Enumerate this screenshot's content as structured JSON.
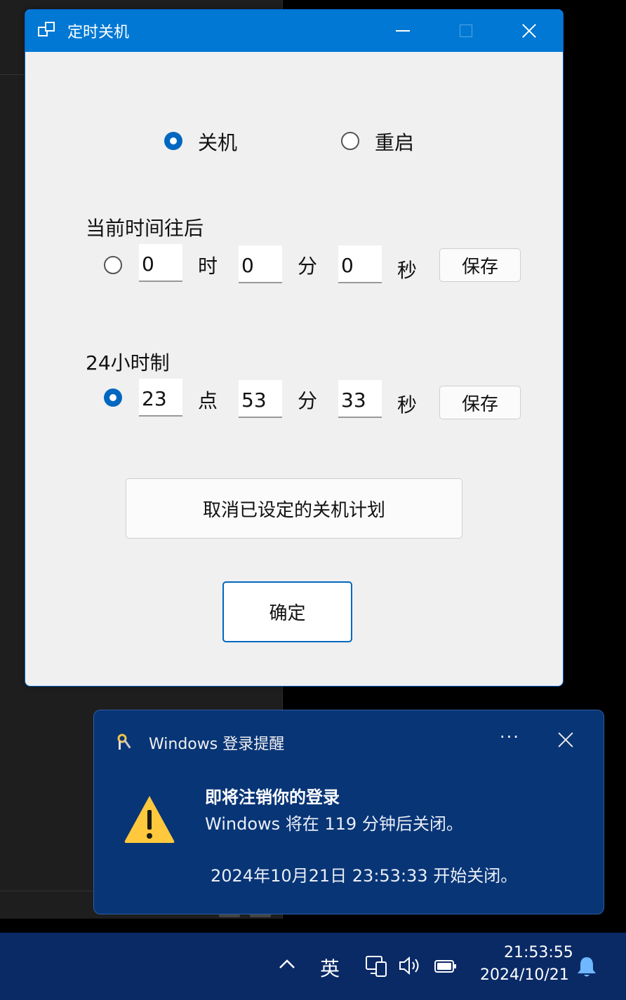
{
  "dialog": {
    "title": "定时关机",
    "mode_options": [
      {
        "label": "关机",
        "selected": true
      },
      {
        "label": "重启",
        "selected": false
      }
    ],
    "relative_section": {
      "heading": "当前时间往后",
      "selected": false,
      "hours": "0",
      "hours_unit": "时",
      "minutes": "0",
      "minutes_unit": "分",
      "seconds": "0",
      "seconds_unit": "秒",
      "save_label": "保存"
    },
    "absolute_section": {
      "heading": "24小时制",
      "selected": true,
      "hours": "23",
      "hours_unit": "点",
      "minutes": "53",
      "minutes_unit": "分",
      "seconds": "33",
      "seconds_unit": "秒",
      "save_label": "保存"
    },
    "cancel_plan_label": "取消已设定的关机计划",
    "confirm_label": "确定"
  },
  "toast": {
    "app_name": "Windows 登录提醒",
    "more_label": "···",
    "title": "即将注销你的登录",
    "body": "Windows 将在 119 分钟后关闭。",
    "schedule": "2024年10月21日 23:53:33 开始关闭。",
    "warning_color": "#ffc83d"
  },
  "taskbar": {
    "ime": "英",
    "time": "21:53:55",
    "date": "2024/10/21"
  },
  "colors": {
    "titlebar": "#0078d4",
    "accent": "#0067c0",
    "toast_bg": "#083576",
    "taskbar_bg": "#0a2a66"
  }
}
